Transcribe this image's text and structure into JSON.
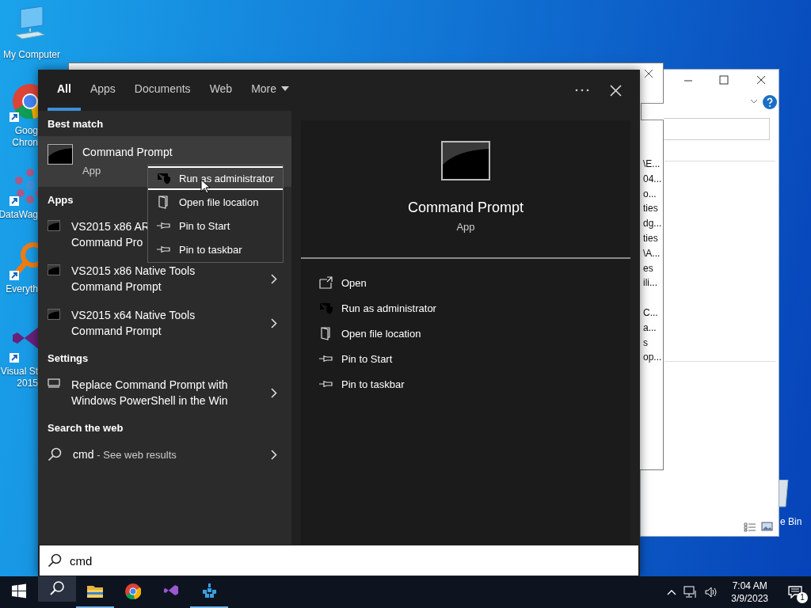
{
  "desktop_icons": [
    {
      "kind": "computer",
      "lines": [
        "My Computer"
      ],
      "shortcut": false
    },
    {
      "kind": "chrome",
      "lines": [
        "Goog",
        "Chron"
      ],
      "shortcut": true
    },
    {
      "kind": "datawag",
      "lines": [
        "DataWag"
      ],
      "shortcut": true
    },
    {
      "kind": "everything",
      "lines": [
        "Everyth"
      ],
      "shortcut": true
    },
    {
      "kind": "vs",
      "lines": [
        "Visual St",
        "2015"
      ],
      "shortcut": true
    }
  ],
  "back_window": {
    "rows": [
      "\\E...",
      "04...",
      "o...",
      "ties",
      "dg...",
      "ties",
      "\\A...",
      "es",
      "ili...",
      "",
      "C...",
      "a...",
      "s",
      "op..."
    ]
  },
  "recycle_bin": {
    "label": "e Bin"
  },
  "search": {
    "tabs": [
      {
        "label": "All",
        "selected": true,
        "kind": "tab"
      },
      {
        "label": "Apps",
        "selected": false,
        "kind": "tab"
      },
      {
        "label": "Documents",
        "selected": false,
        "kind": "tab"
      },
      {
        "label": "Web",
        "selected": false,
        "kind": "tab"
      },
      {
        "label": "More",
        "selected": false,
        "kind": "dropdown"
      }
    ],
    "sections": [
      {
        "header": "Best match",
        "items": [
          {
            "kind": "best",
            "lines": [
              "Command Prompt"
            ],
            "sub": "App",
            "selected": true,
            "arrow": false
          }
        ]
      },
      {
        "header": "Apps",
        "items": [
          {
            "kind": "app",
            "lines": [
              "VS2015 x86 AR",
              "Command Pro"
            ],
            "selected": false,
            "arrow": false
          },
          {
            "kind": "app",
            "lines": [
              "VS2015 x86 Native Tools",
              "Command Prompt"
            ],
            "selected": false,
            "arrow": true
          },
          {
            "kind": "app",
            "lines": [
              "VS2015 x64 Native Tools",
              "Command Prompt"
            ],
            "selected": false,
            "arrow": true
          }
        ]
      },
      {
        "header": "Settings",
        "items": [
          {
            "kind": "setting",
            "lines": [
              "Replace Command Prompt with",
              "Windows PowerShell in the Win"
            ],
            "selected": false,
            "arrow": true
          }
        ]
      },
      {
        "header": "Search the web",
        "items": [
          {
            "kind": "web",
            "lines": [
              "cmd"
            ],
            "suffix": "- See web results",
            "selected": false,
            "arrow": true
          }
        ]
      }
    ],
    "preview": {
      "title": "Command Prompt",
      "subtitle": "App",
      "actions": [
        {
          "label": "Open"
        },
        {
          "label": "Run as administrator"
        },
        {
          "label": "Open file location"
        },
        {
          "label": "Pin to Start"
        },
        {
          "label": "Pin to taskbar"
        }
      ]
    },
    "context_menu": [
      {
        "label": "Run as administrator",
        "selected": true
      },
      {
        "label": "Open file location",
        "selected": false
      },
      {
        "label": "Pin to Start",
        "selected": false
      },
      {
        "label": "Pin to taskbar",
        "selected": false
      }
    ],
    "query": {
      "value": "cmd"
    }
  },
  "taskbar": {
    "apps": [
      {
        "kind": "start",
        "running": false,
        "active": false
      },
      {
        "kind": "search",
        "running": false,
        "active": true
      },
      {
        "kind": "explorer",
        "running": true,
        "active": false
      },
      {
        "kind": "chrome",
        "running": false,
        "active": false
      },
      {
        "kind": "vs",
        "running": false,
        "active": false
      },
      {
        "kind": "datawag",
        "running": true,
        "active": false
      }
    ],
    "time": "7:04 AM",
    "date": "3/9/2023",
    "notification_count": "1"
  }
}
